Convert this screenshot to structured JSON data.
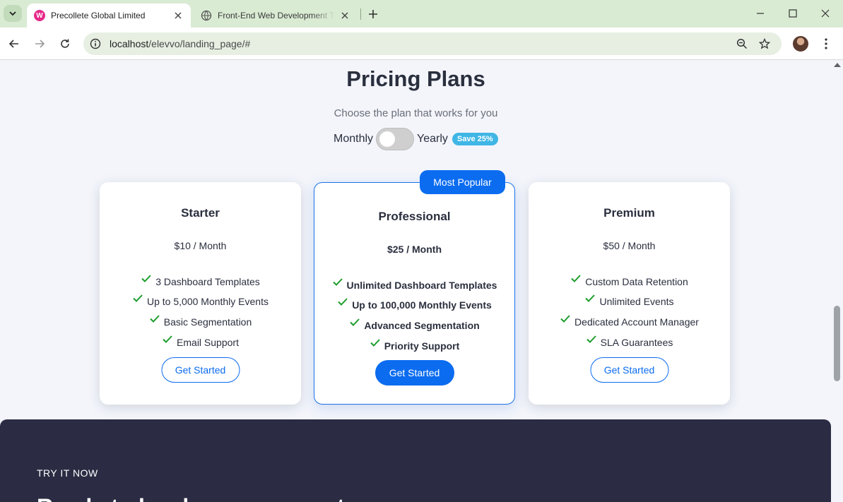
{
  "browser": {
    "tabs": [
      {
        "title": "Precollete Global Limited",
        "favicon": "w-favicon",
        "active": true
      },
      {
        "title": "Front-End Web Development Ta",
        "favicon": "globe-icon",
        "active": false
      }
    ],
    "url": "localhost/elevvo/landing_page/#",
    "url_host": "localhost",
    "url_path": "/elevvo/landing_page/#"
  },
  "pricing": {
    "title": "Pricing Plans",
    "subtitle": "Choose the plan that works for you",
    "monthly_label": "Monthly",
    "yearly_label": "Yearly",
    "save_badge": "Save 25%",
    "toggle_state": "monthly",
    "plans": [
      {
        "name": "Starter",
        "price": "$10 / Month",
        "features": [
          "3 Dashboard Templates",
          "Up to 5,000 Monthly Events",
          "Basic Segmentation",
          "Email Support"
        ],
        "cta": "Get Started"
      },
      {
        "name": "Professional",
        "badge": "Most Popular",
        "price": "$25 / Month",
        "features": [
          "Unlimited Dashboard Templates",
          "Up to 100,000 Monthly Events",
          "Advanced Segmentation",
          "Priority Support"
        ],
        "cta": "Get Started"
      },
      {
        "name": "Premium",
        "price": "$50 / Month",
        "features": [
          "Custom Data Retention",
          "Unlimited Events",
          "Dedicated Account Manager",
          "SLA Guarantees"
        ],
        "cta": "Get Started"
      }
    ]
  },
  "cta_section": {
    "label": "TRY IT NOW",
    "heading": "Ready to level up your agent"
  },
  "colors": {
    "accent": "#0b6cf0",
    "check": "#1a9c2a",
    "badge": "#3fb6e5",
    "dark_section": "#2b2c43"
  }
}
